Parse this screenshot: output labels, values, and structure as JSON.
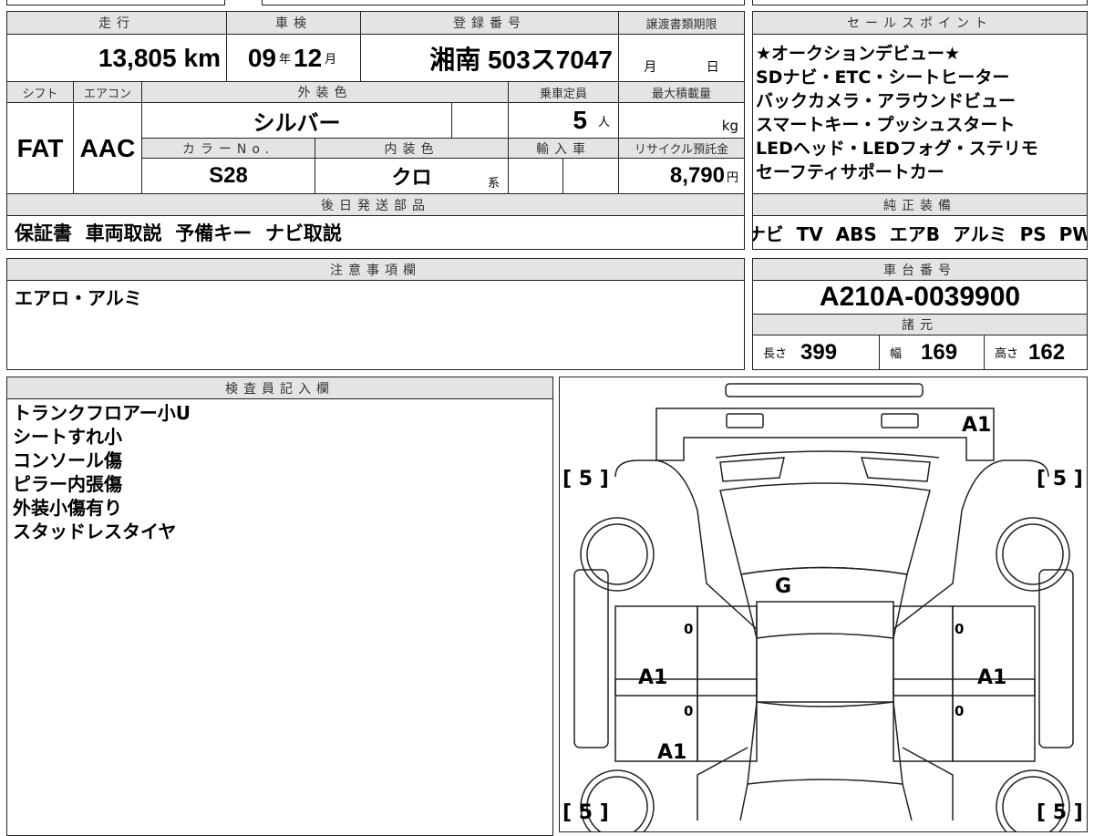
{
  "vehicle": {
    "mileage_label": "走行",
    "mileage": "13,805",
    "mileage_unit": "km",
    "inspection_label": "車検",
    "insp_year": "09",
    "year_unit": "年",
    "insp_month": "12",
    "month_unit": "月",
    "reg_label": "登録番号",
    "reg_number": "湘南 503ス7047",
    "transfer_label": "譲渡書類期限",
    "transfer_month": "月",
    "transfer_day": "日",
    "shift_label": "シフト",
    "shift": "FAT",
    "ac_label": "エアコン",
    "ac": "AAC",
    "exterior_label": "外装色",
    "exterior": "シルバー",
    "capacity_label": "乗車定員",
    "capacity": "5",
    "capacity_unit": "人",
    "load_label": "最大積載量",
    "load_unit": "kg",
    "color_no_label": "カラーNo.",
    "color_no": "S28",
    "interior_label": "内装色",
    "interior": "クロ",
    "interior_unit": "系",
    "import_label": "輸入車",
    "recycle_label": "リサイクル預託金",
    "recycle": "8,790",
    "recycle_unit": "円",
    "later_parts_label": "後日発送部品",
    "later_parts": "保証書  車両取説  予備キー  ナビ取説"
  },
  "sales": {
    "label": "セールスポイント",
    "lines": "★オークションデビュー★\nSDナビ・ETC・シートヒーター\nバックカメラ・アラウンドビュー\nスマートキー・プッシュスタート\nLEDヘッド・LEDフォグ・ステリモ\nセーフティサポートカー"
  },
  "equipment": {
    "label": "純正装備",
    "items": "ナビ  TV  ABS  エアB  アルミ  PS  PW"
  },
  "notes": {
    "label": "注意事項欄",
    "text": "エアロ・アルミ"
  },
  "chassis": {
    "label": "車台番号",
    "number": "A210A-0039900",
    "spec_label": "諸元",
    "length_label": "長さ",
    "length": "399",
    "width_label": "幅",
    "width": "169",
    "height_label": "高さ",
    "height": "162"
  },
  "inspector": {
    "label": "検査員記入欄",
    "lines": "トランクフロアー小U\nシートすれ小\nコンソール傷\nピラー内張傷\n外装小傷有り\nスタッドレスタイヤ"
  },
  "diagram": {
    "marks": {
      "rear": "A1",
      "center": "G",
      "left_door": "A1",
      "right_door": "A1",
      "left_front": "A1",
      "tire_fl": "5",
      "tire_fr": "5",
      "tire_rl": "5",
      "tire_rr": "5",
      "door_zero": "0"
    }
  }
}
